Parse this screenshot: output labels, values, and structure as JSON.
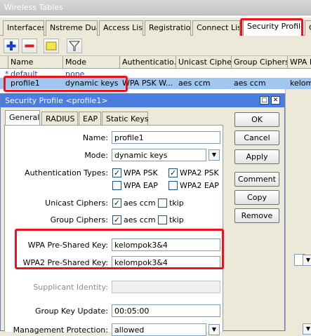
{
  "window": {
    "title": "Wireless Tables"
  },
  "tabs": [
    {
      "label": "Interfaces"
    },
    {
      "label": "Nstreme Dual"
    },
    {
      "label": "Access List"
    },
    {
      "label": "Registration"
    },
    {
      "label": "Connect List"
    },
    {
      "label": "Security Profiles"
    },
    {
      "label": "C"
    }
  ],
  "table": {
    "columns": [
      "Name",
      "Mode",
      "Authenticatio...",
      "Unicast Ciphers",
      "Group Ciphers",
      "WPA P"
    ],
    "rows": [
      {
        "marker": "*",
        "name": "default",
        "mode": "none",
        "auth": "",
        "unicast": "",
        "group": "",
        "wpa": ""
      },
      {
        "marker": "",
        "name": "profile1",
        "mode": "dynamic keys",
        "auth": "WPA PSK W...",
        "unicast": "aes ccm",
        "group": "aes ccm",
        "wpa": "kelomp"
      }
    ]
  },
  "dialog": {
    "title": "Security Profile <profile1>",
    "tabs": [
      "General",
      "RADIUS",
      "EAP",
      "Static Keys"
    ],
    "fields": {
      "name_label": "Name:",
      "name_value": "profile1",
      "mode_label": "Mode:",
      "mode_value": "dynamic keys",
      "auth_label": "Authentication Types:",
      "auth_wpa_psk": "WPA PSK",
      "auth_wpa2_psk": "WPA2 PSK",
      "auth_wpa_eap": "WPA EAP",
      "auth_wpa2_eap": "WPA2 EAP",
      "unicast_label": "Unicast Ciphers:",
      "unicast_aes": "aes ccm",
      "unicast_tkip": "tkip",
      "group_label": "Group Ciphers:",
      "group_aes": "aes ccm",
      "group_tkip": "tkip",
      "wpa_psk_label": "WPA Pre-Shared Key:",
      "wpa_psk_value": "kelompok3&4",
      "wpa2_psk_label": "WPA2 Pre-Shared Key:",
      "wpa2_psk_value": "kelompok3&4",
      "supplicant_label": "Supplicant Identity:",
      "supplicant_value": "",
      "group_key_label": "Group Key Update:",
      "group_key_value": "00:05:00",
      "mgmt_label": "Management Protection:",
      "mgmt_value": "allowed"
    },
    "buttons": [
      "OK",
      "Cancel",
      "Apply",
      "Comment",
      "Copy",
      "Remove"
    ]
  },
  "colors": {
    "highlight": "#e8141e",
    "selection": "#9fc6ef",
    "titlebar": "#4b7ce0"
  }
}
